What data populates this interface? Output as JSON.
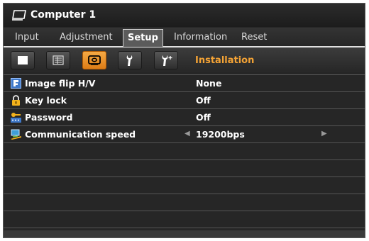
{
  "window": {
    "title": "Computer 1",
    "source_icon": "monitor-icon"
  },
  "menu": {
    "tabs": [
      {
        "label": "Input"
      },
      {
        "label": "Adjustment"
      },
      {
        "label": "Setup",
        "active": true
      },
      {
        "label": "Information"
      },
      {
        "label": "Reset"
      }
    ]
  },
  "toolbar": {
    "buttons": [
      {
        "icon": "screen-icon"
      },
      {
        "icon": "menu-grid-icon"
      },
      {
        "icon": "installation-icon",
        "active": true
      },
      {
        "icon": "wrench-icon"
      },
      {
        "icon": "wrench-plus-icon"
      }
    ],
    "section_title": "Installation"
  },
  "settings": [
    {
      "label": "Image flip H/V",
      "value": "None",
      "icon": "image-flip-icon"
    },
    {
      "label": "Key lock",
      "value": "Off",
      "icon": "lock-icon"
    },
    {
      "label": "Password",
      "value": "Off",
      "icon": "password-icon"
    },
    {
      "label": "Communication speed",
      "value": "19200bps",
      "icon": "communication-icon",
      "adjustable": true
    }
  ],
  "colors": {
    "accent": "#f4a335",
    "background": "#262626",
    "text": "#ffffff"
  }
}
